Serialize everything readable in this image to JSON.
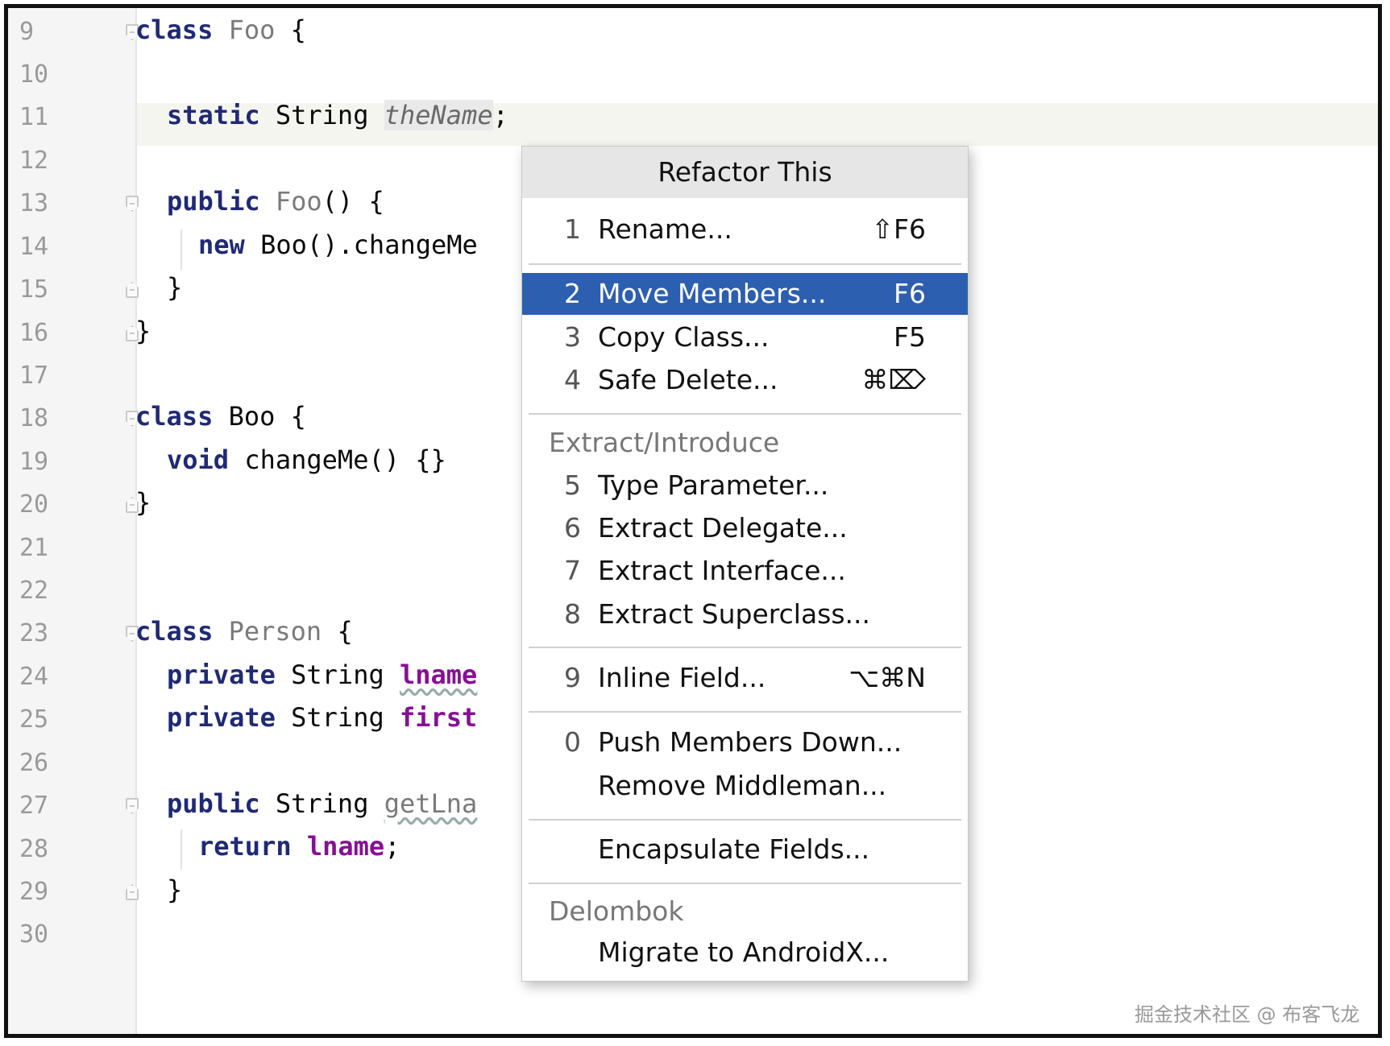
{
  "editor": {
    "line_numbers": [
      "9",
      "10",
      "11",
      "12",
      "13",
      "14",
      "15",
      "16",
      "17",
      "18",
      "19",
      "20",
      "21",
      "22",
      "23",
      "24",
      "25",
      "26",
      "27",
      "28",
      "29",
      "30"
    ],
    "lines": {
      "l9_kw": "class",
      "l9_name": "Foo",
      "l9_brace": "{",
      "l11_kw": "static",
      "l11_type": "String",
      "l11_field": "theName",
      "l11_semi": ";",
      "l13_kw": "public",
      "l13_name": "Foo",
      "l13_rest": "() {",
      "l14_kw": "new",
      "l14_rest": "Boo().changeMe",
      "l15": "}",
      "l16": "}",
      "l18_kw": "class",
      "l18_name": "Boo",
      "l18_brace": "{",
      "l19_kw": "void",
      "l19_rest": "changeMe() {}",
      "l20": "}",
      "l23_kw": "class",
      "l23_name": "Person",
      "l23_brace": "{",
      "l24_kw": "private",
      "l24_type": "String",
      "l24_field": "lname",
      "l25_kw": "private",
      "l25_type": "String",
      "l25_field": "first",
      "l27_kw": "public",
      "l27_type": "String",
      "l27_name": "getLna",
      "l28_kw": "return",
      "l28_field": "lname",
      "l28_semi": ";",
      "l29": "}"
    }
  },
  "popup": {
    "title": "Refactor This",
    "items": [
      {
        "num": "1",
        "label": "Rename...",
        "shortcut": "⇧F6"
      },
      {
        "num": "2",
        "label": "Move Members...",
        "shortcut": "F6",
        "selected": true
      },
      {
        "num": "3",
        "label": "Copy Class...",
        "shortcut": "F5"
      },
      {
        "num": "4",
        "label": "Safe Delete...",
        "shortcut": "⌘⌦"
      },
      {
        "num": "5",
        "label": "Type Parameter..."
      },
      {
        "num": "6",
        "label": "Extract Delegate..."
      },
      {
        "num": "7",
        "label": "Extract Interface..."
      },
      {
        "num": "8",
        "label": "Extract Superclass..."
      },
      {
        "num": "9",
        "label": "Inline Field...",
        "shortcut": "⌥⌘N"
      },
      {
        "num": "0",
        "label": "Push Members Down..."
      },
      {
        "num": "",
        "label": "Remove Middleman..."
      },
      {
        "num": "",
        "label": "Encapsulate Fields..."
      },
      {
        "num": "",
        "label": "Migrate to AndroidX..."
      }
    ],
    "groups": {
      "extract": "Extract/Introduce",
      "delombok": "Delombok"
    }
  },
  "watermark": "掘金技术社区 @ 布客飞龙",
  "colors": {
    "selection": "#2d5fb0",
    "keyword": "#1f2a76",
    "field": "#871094"
  }
}
